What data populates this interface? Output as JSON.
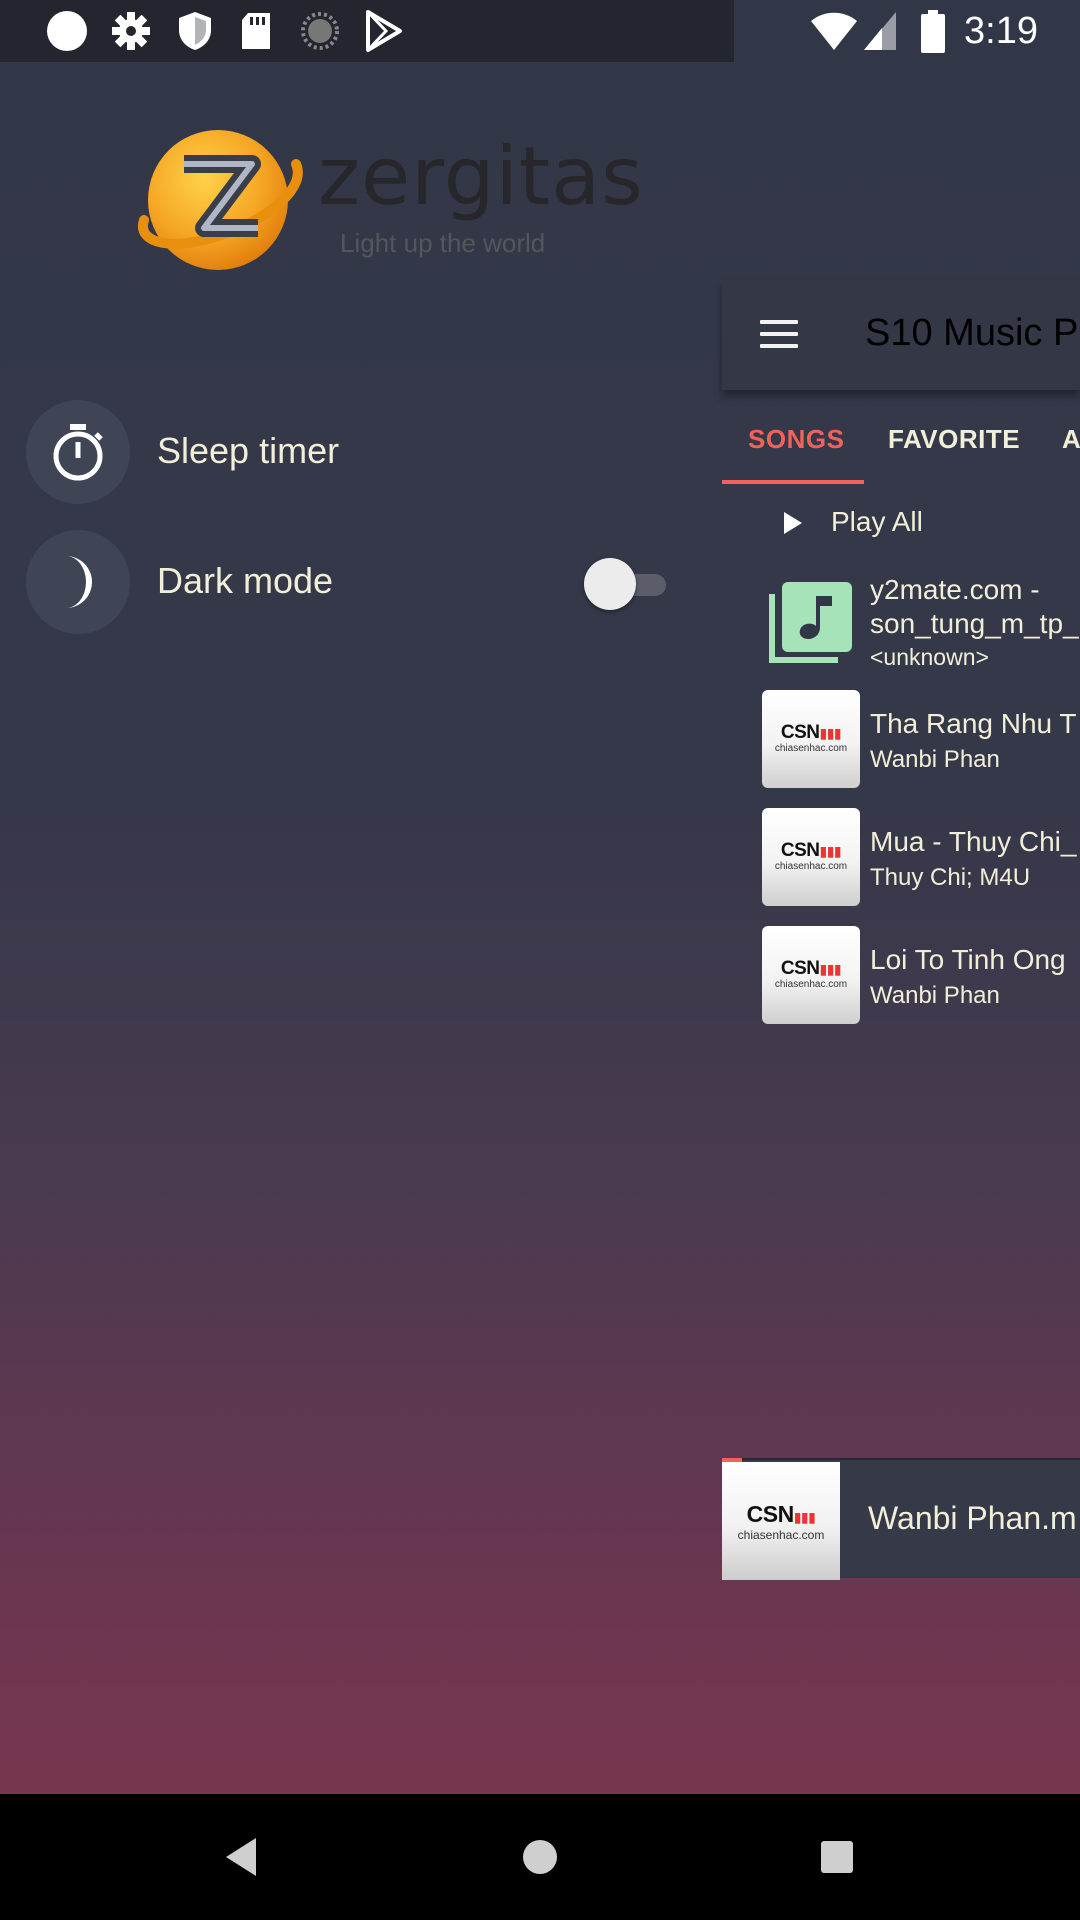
{
  "status_bar": {
    "time": "3:19",
    "left_icons": [
      "circle-icon",
      "gear-icon",
      "shield-icon",
      "sd-card-icon",
      "spinner-icon",
      "play-store-icon"
    ],
    "right_icons": [
      "wifi-icon",
      "signal-icon",
      "battery-icon"
    ]
  },
  "drawer": {
    "logo": {
      "name": "zergitas",
      "tagline": "Light up the world"
    },
    "items": [
      {
        "label": "Sleep timer",
        "icon": "stopwatch-icon"
      },
      {
        "label": "Dark mode",
        "icon": "moon-icon",
        "toggle_on": false
      }
    ]
  },
  "app": {
    "title": "S10 Music P",
    "tabs": [
      {
        "label": "SONGS",
        "active": true
      },
      {
        "label": "FAVORITE",
        "active": false
      },
      {
        "label": "A",
        "active": false
      }
    ],
    "play_all_label": "Play All",
    "songs": [
      {
        "title_line1": "y2mate.com -",
        "title_line2": "son_tung_m_tp_",
        "artist": "<unknown>",
        "thumb": "music-note-icon"
      },
      {
        "title": "Tha Rang Nhu T",
        "artist": "Wanbi Phan",
        "thumb_logo": "CSN",
        "thumb_sub": "chiasenhac.com"
      },
      {
        "title": "Mua - Thuy Chi_",
        "artist": "Thuy Chi; M4U",
        "thumb_logo": "CSN",
        "thumb_sub": "chiasenhac.com"
      },
      {
        "title": "Loi To Tinh Ong",
        "artist": "Wanbi Phan",
        "thumb_logo": "CSN",
        "thumb_sub": "chiasenhac.com"
      }
    ],
    "mini_player": {
      "title": "Wanbi Phan.m",
      "thumb_logo": "CSN",
      "thumb_sub": "chiasenhac.com"
    }
  },
  "colors": {
    "accent": "#f0635a",
    "text": "#f2efd8",
    "logo_orange": "#f39c12"
  },
  "nav_bar": {
    "buttons": [
      "back-icon",
      "home-icon",
      "recents-icon"
    ]
  }
}
